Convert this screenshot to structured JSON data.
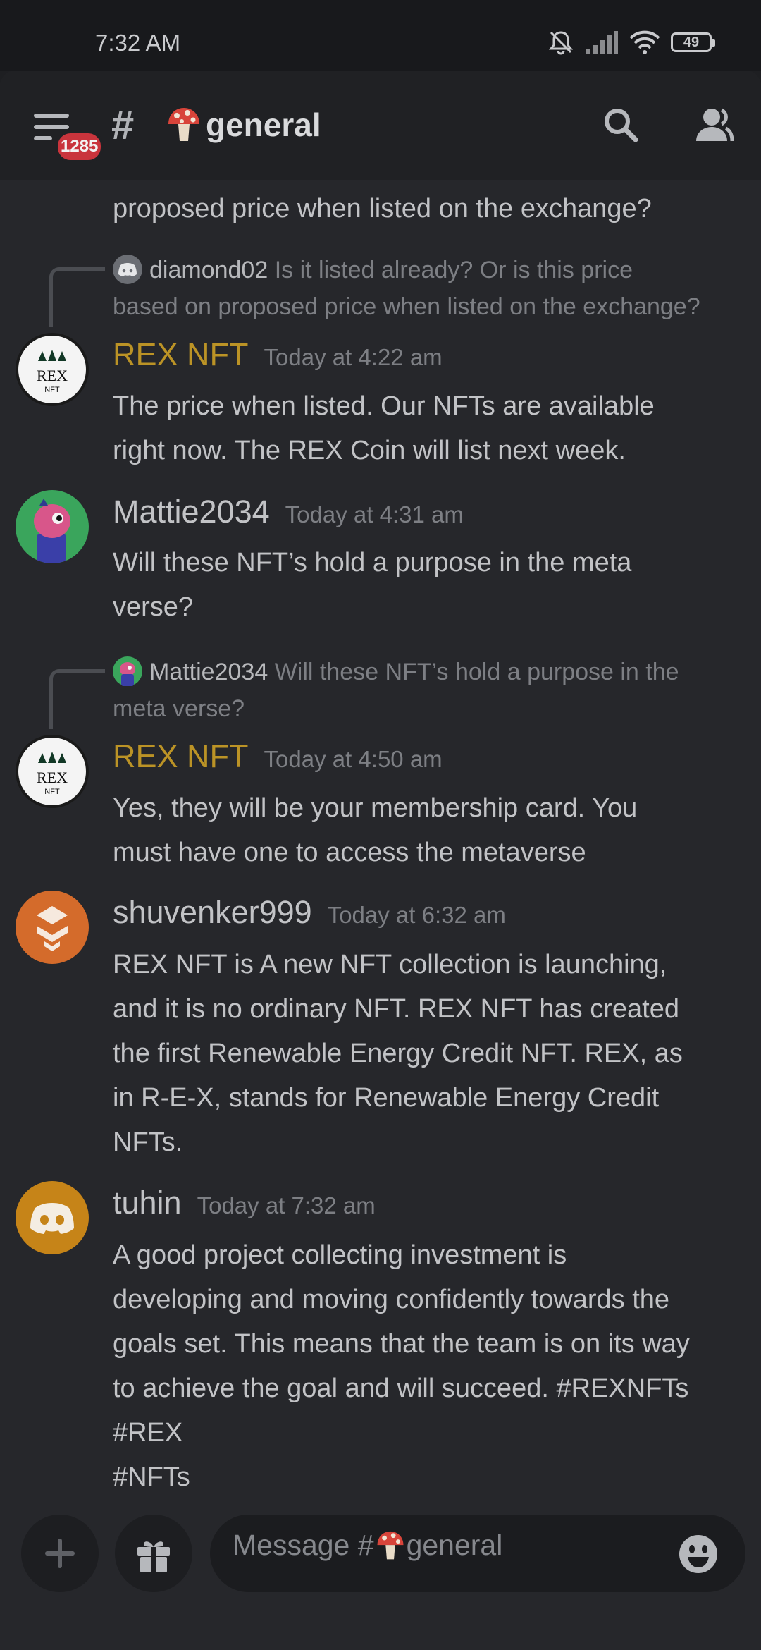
{
  "status_bar": {
    "time": "7:32 AM",
    "battery": "49"
  },
  "header": {
    "mention_count": "1285",
    "channel_name": "general",
    "channel_emoji": "mushroom-emoji"
  },
  "colors": {
    "background": "#26272b",
    "header": "#202124",
    "gold_role": "#bb9326",
    "badge_red": "#c9343c"
  },
  "messages": {
    "cutoff_line": "proposed price when listed on the exchange?",
    "reply1": {
      "name": "diamond02",
      "text_line1": "Is it listed already? Or is this price",
      "text_line2": "based on proposed price when listed on the exchange?"
    },
    "msg1": {
      "author": "REX NFT",
      "time": "Today at 4:22 am",
      "lines": [
        "The price when listed.  Our NFTs are available",
        "right now.  The REX Coin will list next week."
      ]
    },
    "msg2": {
      "author": "Mattie2034",
      "time": "Today at 4:31 am",
      "lines": [
        "Will these NFT’s hold a purpose in the meta",
        "verse?"
      ]
    },
    "reply2": {
      "name": "Mattie2034",
      "text_line1": "Will these NFT’s hold a purpose in the",
      "text_line2": "meta verse?"
    },
    "msg3": {
      "author": "REX NFT",
      "time": "Today at 4:50 am",
      "lines": [
        "Yes, they will be your membership card. You",
        "must have one to access the metaverse"
      ]
    },
    "msg4": {
      "author": "shuvenker999",
      "time": "Today at 6:32 am",
      "lines": [
        "REX NFT is A new NFT collection is launching,",
        "and it is no ordinary NFT. REX NFT has created",
        "the first Renewable Energy Credit NFT. REX, as",
        "in R-E-X, stands for Renewable Energy Credit",
        "NFTs."
      ]
    },
    "msg5": {
      "author": "tuhin",
      "time": "Today at 7:32 am",
      "lines": [
        "A good project collecting investment is",
        "developing and moving confidently towards the",
        "goals set. This means that the team is on its way",
        "to achieve the goal and will succeed. #REXNFTs",
        "#REX",
        "#NFTs"
      ]
    },
    "rex_avatar_text": "REX",
    "rex_avatar_subtext": "NFT"
  },
  "composer": {
    "placeholder_prefix": "Message #",
    "placeholder_channel": "general"
  }
}
